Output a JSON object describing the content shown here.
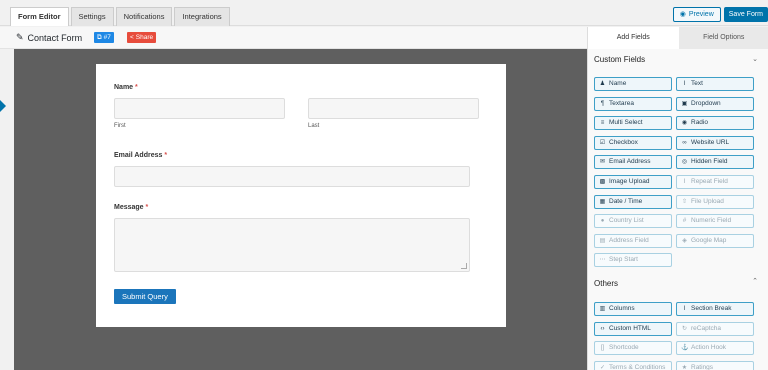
{
  "tabs": [
    "Form Editor",
    "Settings",
    "Notifications",
    "Integrations"
  ],
  "actions": {
    "preview": "Preview",
    "save": "Save Form"
  },
  "form": {
    "title": "Contact Form",
    "id_badge": "#7",
    "share_label": "Share"
  },
  "fields": {
    "name_label": "Name",
    "required_mark": "*",
    "first_label": "First",
    "last_label": "Last",
    "email_label": "Email Address",
    "message_label": "Message",
    "submit": "Submit Query"
  },
  "panel": {
    "tab_add": "Add Fields",
    "tab_options": "Field Options",
    "custom_title": "Custom Fields",
    "others_title": "Others",
    "custom_fields": [
      {
        "label": "Name",
        "icon": "person-icon",
        "disabled": false
      },
      {
        "label": "Text",
        "icon": "text-cursor-icon",
        "disabled": false
      },
      {
        "label": "Textarea",
        "icon": "paragraph-icon",
        "disabled": false
      },
      {
        "label": "Dropdown",
        "icon": "dropdown-icon",
        "disabled": false
      },
      {
        "label": "Multi Select",
        "icon": "list-icon",
        "disabled": false
      },
      {
        "label": "Radio",
        "icon": "radio-icon",
        "disabled": false
      },
      {
        "label": "Checkbox",
        "icon": "checkbox-icon",
        "disabled": false
      },
      {
        "label": "Website URL",
        "icon": "link-icon",
        "disabled": false
      },
      {
        "label": "Email Address",
        "icon": "envelope-icon",
        "disabled": false
      },
      {
        "label": "Hidden Field",
        "icon": "eye-slash-icon",
        "disabled": false
      },
      {
        "label": "Image Upload",
        "icon": "image-icon",
        "disabled": false
      },
      {
        "label": "Repeat Field",
        "icon": "text-cursor-icon",
        "disabled": true
      },
      {
        "label": "Date / Time",
        "icon": "calendar-icon",
        "disabled": false
      },
      {
        "label": "File Upload",
        "icon": "upload-icon",
        "disabled": true
      },
      {
        "label": "Country List",
        "icon": "globe-icon",
        "disabled": true
      },
      {
        "label": "Numeric Field",
        "icon": "hash-icon",
        "disabled": true
      },
      {
        "label": "Address Field",
        "icon": "address-icon",
        "disabled": true
      },
      {
        "label": "Google Map",
        "icon": "map-pin-icon",
        "disabled": true
      },
      {
        "label": "Step Start",
        "icon": "steps-icon",
        "disabled": true
      }
    ],
    "other_fields": [
      {
        "label": "Columns",
        "icon": "columns-icon",
        "disabled": false
      },
      {
        "label": "Section Break",
        "icon": "section-break-icon",
        "disabled": false
      },
      {
        "label": "Custom HTML",
        "icon": "code-icon",
        "disabled": false
      },
      {
        "label": "reCaptcha",
        "icon": "recaptcha-icon",
        "disabled": true
      },
      {
        "label": "Shortcode",
        "icon": "shortcode-icon",
        "disabled": true
      },
      {
        "label": "Action Hook",
        "icon": "anchor-icon",
        "disabled": true
      },
      {
        "label": "Terms & Conditions",
        "icon": "terms-icon",
        "disabled": true
      },
      {
        "label": "Ratings",
        "icon": "star-icon",
        "disabled": true
      }
    ]
  }
}
